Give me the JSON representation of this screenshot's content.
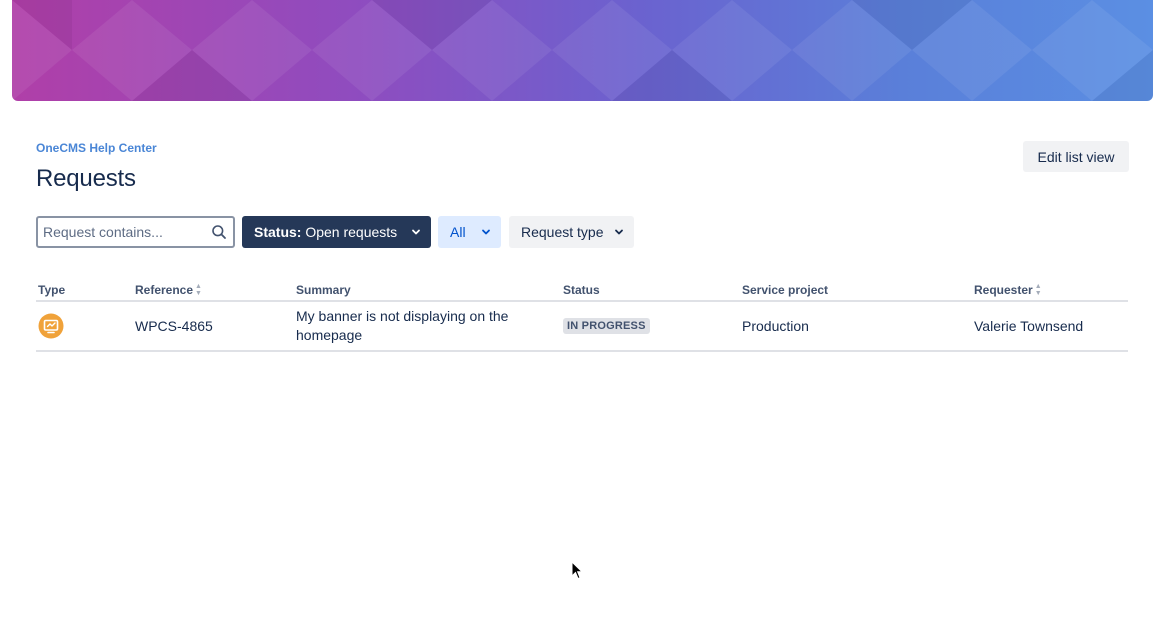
{
  "banner": {
    "accent_start": "#b03fa8",
    "accent_end": "#5b8fe3"
  },
  "breadcrumb": {
    "label": "OneCMS Help Center"
  },
  "page": {
    "title": "Requests"
  },
  "actions": {
    "edit_list_view": "Edit list view"
  },
  "search": {
    "placeholder": "Request contains...",
    "value": "",
    "icon": "search-icon"
  },
  "filters": {
    "status": {
      "label": "Status:",
      "value": "Open requests"
    },
    "scope": {
      "value": "All"
    },
    "request_type": {
      "value": "Request type"
    }
  },
  "table": {
    "columns": {
      "type": "Type",
      "reference": "Reference",
      "summary": "Summary",
      "status": "Status",
      "service_project": "Service project",
      "requester": "Requester"
    },
    "rows": [
      {
        "type_icon": "orange-request-type-icon",
        "reference": "WPCS-4865",
        "summary": "My banner is not displaying on the homepage",
        "status": "IN PROGRESS",
        "service_project": "Production",
        "requester": "Valerie Townsend"
      }
    ]
  },
  "colors": {
    "breadcrumb": "#4a86d6",
    "status_filter_bg": "#253858",
    "all_filter_bg": "#deebff",
    "all_filter_text": "#0052cc",
    "type_icon": "#f0a23a"
  }
}
